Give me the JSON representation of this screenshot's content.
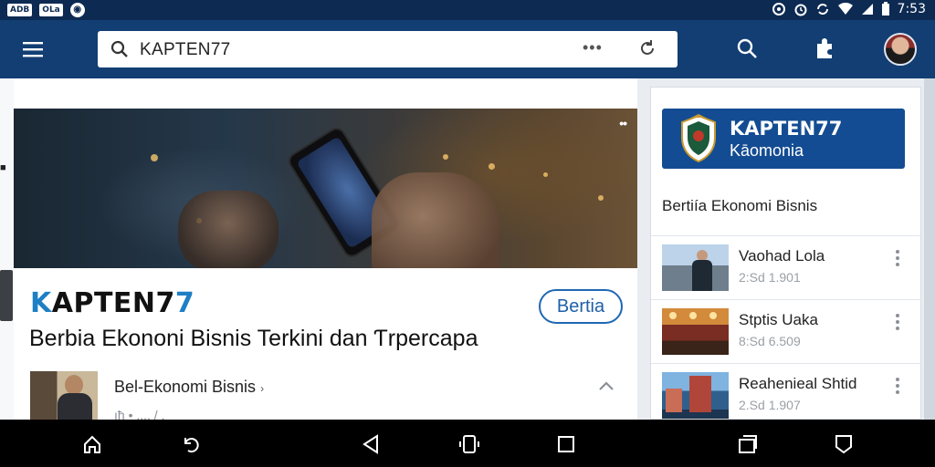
{
  "status_bar": {
    "left_chips": [
      "ADB",
      "OLa"
    ],
    "time": "7:53",
    "icons": [
      "notification-icon",
      "alarm-icon",
      "sync-icon",
      "wifi-icon",
      "signal-icon",
      "battery-icon"
    ]
  },
  "app_bar": {
    "search_value": "KAPTEN77",
    "more_label": "•••",
    "icons": [
      "menu-icon",
      "search-icon",
      "refresh-icon",
      "extension-icon"
    ]
  },
  "hero": {
    "more_label": "••"
  },
  "article": {
    "brand_k": "K",
    "brand_mid": "APTEN7",
    "brand_seven": "7",
    "pill_label": "Bertia",
    "headline": "Berbia Ekononi Bisnis Terkini dan Ƭrpercapa",
    "row_title": "Bel-Ekonomi Bisnis",
    "row_sub": "ıħ • ..., / ,"
  },
  "right_panel": {
    "banner_title": "KAPTEN77",
    "banner_subtitle": "Kāomonia",
    "section_title": "Bertiía Ekonomi Bisnis",
    "news": [
      {
        "title": "Vaohad Lola",
        "meta": "2:Sd 1.901"
      },
      {
        "title": "Stptis Uaka",
        "meta": "8:Sd 6.509"
      },
      {
        "title": "Reahenieal Shtid",
        "meta": "2.Sd 1.907"
      }
    ]
  },
  "colors": {
    "status_bar": "#0d2a52",
    "app_bar": "#123e73",
    "accent_blue": "#1e7fc4",
    "banner": "#134c92",
    "nav_bar": "#000000"
  }
}
